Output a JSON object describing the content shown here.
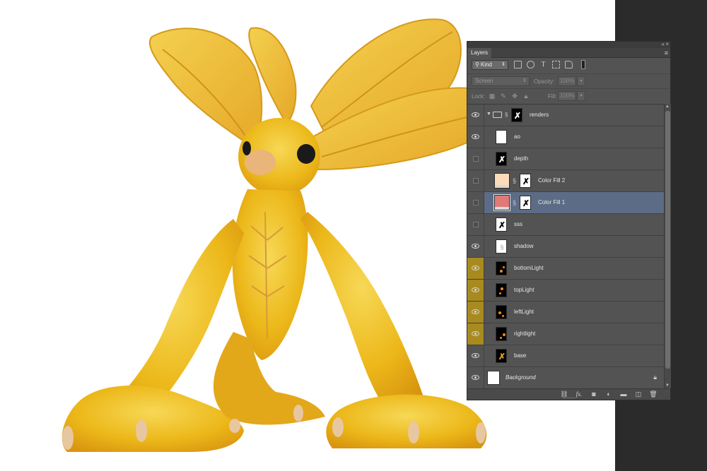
{
  "panel": {
    "tab_label": "Layers",
    "collapse_icon": "double-chevron-icon",
    "close_icon": "close-icon",
    "menu_icon": "panel-menu-icon"
  },
  "filter": {
    "kind_label": "Kind",
    "icons": [
      "pixel-filter-icon",
      "adjustment-filter-icon",
      "type-filter-icon",
      "shape-filter-icon",
      "smart-object-filter-icon"
    ]
  },
  "blend": {
    "mode": "Screen",
    "opacity_label": "Opacity:",
    "opacity_value": "100%"
  },
  "lock": {
    "label": "Lock:",
    "icons": [
      "lock-transparent-icon",
      "lock-image-icon",
      "lock-position-icon",
      "lock-all-icon"
    ],
    "fill_label": "Fill:",
    "fill_value": "100%"
  },
  "layers": [
    {
      "name": "renders",
      "type": "group",
      "visible": true
    },
    {
      "name": "ao",
      "type": "layer",
      "visible": true
    },
    {
      "name": "depth",
      "type": "layer",
      "visible": false
    },
    {
      "name": "Color Fill 2",
      "type": "fill",
      "visible": false,
      "color": "#fcdcb8"
    },
    {
      "name": "Color Fill 1",
      "type": "fill",
      "visible": false,
      "color": "#e07a78",
      "selected": true
    },
    {
      "name": "sss",
      "type": "layer",
      "visible": false
    },
    {
      "name": "shadow",
      "type": "layer",
      "visible": true
    },
    {
      "name": "bottomLight",
      "type": "light",
      "visible": true
    },
    {
      "name": "topLight",
      "type": "light",
      "visible": true
    },
    {
      "name": "leftLight",
      "type": "light",
      "visible": true
    },
    {
      "name": "rightlight",
      "type": "light",
      "visible": true
    },
    {
      "name": "base",
      "type": "layer",
      "visible": true
    },
    {
      "name": "Background",
      "type": "background",
      "visible": true,
      "locked": true
    }
  ],
  "bottom_icons": [
    "link-layers-icon",
    "fx-icon",
    "add-mask-icon",
    "new-adjustment-icon",
    "new-group-icon",
    "new-layer-icon",
    "delete-icon"
  ],
  "bottom_fx_label": "fx.",
  "colors": {
    "panel_bg": "#535353",
    "selected_row": "#5c6c86",
    "light_layer_vis": "#a88a1f",
    "creature_yellow": "#f2c21a"
  }
}
